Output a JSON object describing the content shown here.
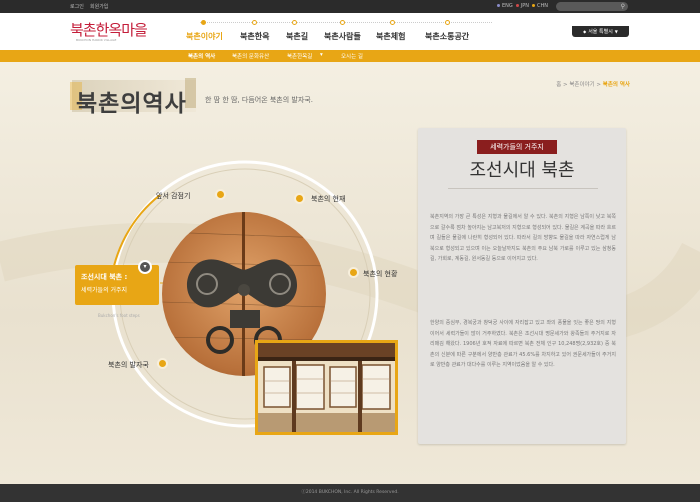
{
  "top_bar": {
    "links": [
      "로그인",
      "회원가입"
    ],
    "languages": [
      {
        "label": "ENG",
        "color": "#8a8cc8"
      },
      {
        "label": "JPN",
        "color": "#d04a4a"
      },
      {
        "label": "CHN",
        "color": "#e8a615"
      }
    ]
  },
  "header": {
    "logo_text": "북촌한옥마을",
    "logo_sub": "BUKCHON HANOK VILLAGE",
    "nav": [
      "북촌이야기",
      "북촌한옥",
      "북촌길",
      "북촌사람들",
      "북촌체험",
      "북촌소통공간"
    ],
    "active_nav": "북촌이야기",
    "region_label": "서울 특별시"
  },
  "sub_nav": {
    "items": [
      "북촌의 역사",
      "북촌의 문화유산",
      "북촌한옥길",
      "오시는 길"
    ],
    "active": "북촌의 역사"
  },
  "page": {
    "title": "북촌의역사",
    "subtitle": "한 땀 한 땀, 다듬어온 북촌의 발자국.",
    "breadcrumb": [
      "홈",
      "북촌이야기",
      "북촌의 역사"
    ]
  },
  "diagram": {
    "labels": [
      "앞서 감점기",
      "북촌의 현재",
      "북촌의 현황",
      "북촌의 발자국"
    ],
    "selected_title": "조선시대 북촌 :",
    "selected_sub": "세력가들의 거주지",
    "caption": "Bukchon's foot steps"
  },
  "panel": {
    "tag": "세력가들의 거주지",
    "title": "조선시대 북촌",
    "para1": "북촌지역의 가장 큰 특성은 지형과 물길에서 알 수 있다. 북촌의 지형은 남쪽이 낮고 북쪽으로 갈수록 점차 높아지는 남고북저의 지형으로 형성되어 있다. 물길은 계곡을 따라 흐르며 길들은 물길에 나란히 형성되어 있다. 따라서 길의 방향도 물길을 따라 자연스럽게 남북으로 형성되고 있으며 이는 오늘날까지도 북촌의 주요 남북 가로를 이루고 있는 삼청동길, 가회로, 계동길, 원서동길 등으로 이어지고 있다.",
    "para2": "한양의 중심부, 경복궁과 창덕궁 사이에 자리잡고 있고 좌의 풍물을 잇는 좋은 땅의 지형이어서 세력가들이 많이 거주하였다. 북촌은 조선시대 명문세가와 왕족들의 주거지로 자리매김 해왔다. 1906년 호적 자료에 따르면 북촌 전체 인구 10,248명(2,932호) 중 북촌의 신분에 따른 구분에서 양반층 관료가 45.6%를 차지하고 있어 권문세가들이 주거지로 양반층 관료가 대다수를 이루는 지역이었음을 알 수 있다."
  },
  "footer": {
    "text": "ⓒ2014 BUKCHON, Inc. All Rights Reserved."
  }
}
